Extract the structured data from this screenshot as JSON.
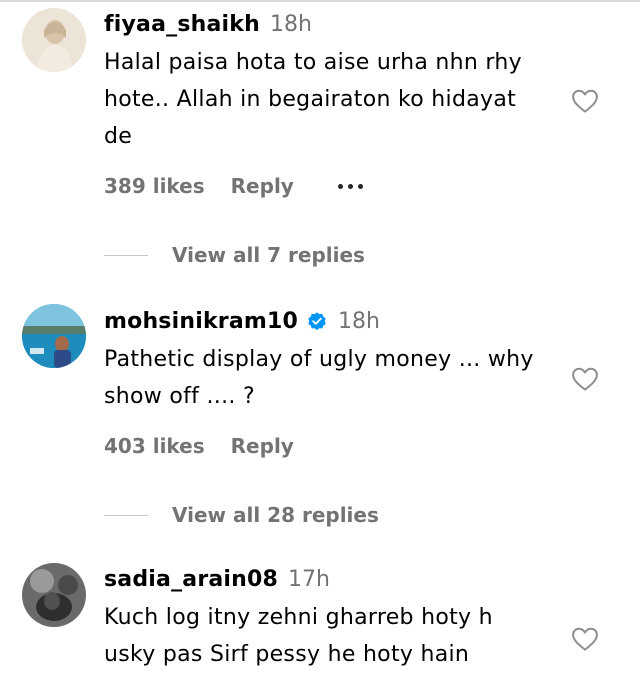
{
  "comments": [
    {
      "username": "fiyaa_shaikh",
      "verified": false,
      "time": "18h",
      "text": "Halal paisa hota to aise urha nhn rhy hote.. Allah in begairaton ko hidayat de",
      "likes": "389 likes",
      "reply": "Reply",
      "view_replies": "View all 7 replies"
    },
    {
      "username": "mohsinikram10",
      "verified": true,
      "time": "18h",
      "text": "Pathetic display of ugly money ... why show off .... ?",
      "likes": "403 likes",
      "reply": "Reply",
      "view_replies": "View all 28 replies"
    },
    {
      "username": "sadia_arain08",
      "verified": false,
      "time": "17h",
      "text": "Kuch log itny zehni gharreb hoty h usky pas Sirf pessy he hoty hain"
    }
  ],
  "icons": {
    "like": "heart-outline-icon",
    "verified": "verified-badge-icon",
    "more": "more-options-icon"
  },
  "colors": {
    "text_primary": "#000000",
    "text_secondary": "#737373",
    "verified_blue": "#0095f6"
  }
}
